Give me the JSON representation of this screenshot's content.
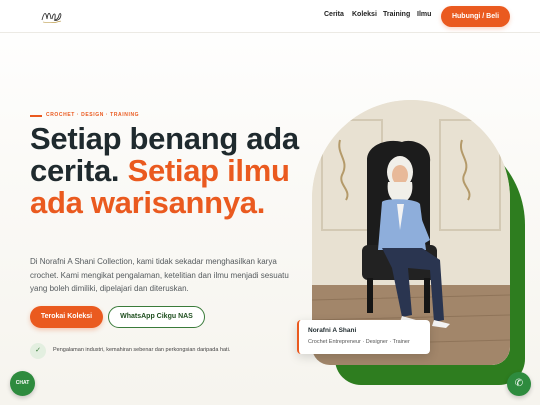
{
  "header": {
    "logo_text": "NAS",
    "nav": [
      "Cerita",
      "Koleksi",
      "Training",
      "Ilmu"
    ],
    "cta_label": "Hubungi / Beli"
  },
  "hero": {
    "eyebrow": "CROCHET · DESIGN · TRAINING",
    "headline_part1": "Setiap benang ada cerita.",
    "headline_part2": "Setiap ilmu ada warisannya.",
    "description": "Di Norafni A Shani Collection, kami tidak sekadar menghasilkan karya crochet. Kami mengikat pengalaman, ketelitian dan ilmu menjadi sesuatu yang boleh dimiliki, dipelajari dan diteruskan.",
    "primary_button": "Terokai Koleksi",
    "secondary_button": "WhatsApp Cikgu NAS",
    "bullet": "Pengalaman industri, kemahiran sebenar dan perkongsian daripada hati."
  },
  "profile_card": {
    "name": "Norafni A Shani",
    "role": "Crochet Entrepreneur · Designer · Trainer"
  },
  "floating": {
    "chat_label": "CHAT",
    "whatsapp_icon": "phone-icon"
  },
  "colors": {
    "accent": "#ea5a1f",
    "green": "#2e7d1f",
    "text": "#1f2a2e"
  }
}
